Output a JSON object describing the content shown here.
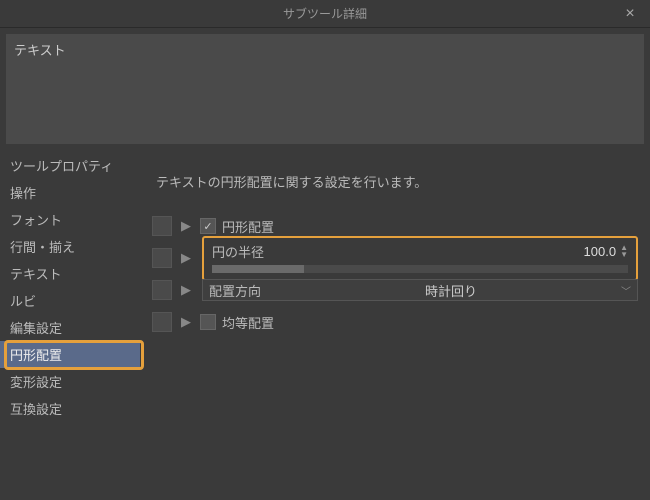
{
  "window": {
    "title": "サブツール詳細"
  },
  "preview": {
    "text": "テキスト"
  },
  "sidebar": {
    "items": [
      {
        "label": "ツールプロパティ"
      },
      {
        "label": "操作"
      },
      {
        "label": "フォント"
      },
      {
        "label": "行間・揃え"
      },
      {
        "label": "テキスト"
      },
      {
        "label": "ルビ"
      },
      {
        "label": "編集設定"
      },
      {
        "label": "円形配置"
      },
      {
        "label": "変形設定"
      },
      {
        "label": "互換設定"
      }
    ],
    "selected_index": 7
  },
  "content": {
    "description": "テキストの円形配置に関する設定を行います。",
    "circular_placement": {
      "label": "円形配置",
      "checked": true
    },
    "circle_radius": {
      "label": "円の半径",
      "value": "100.0"
    },
    "placement_direction": {
      "label": "配置方向",
      "value": "時計回り"
    },
    "equal_placement": {
      "label": "均等配置",
      "checked": false
    }
  }
}
